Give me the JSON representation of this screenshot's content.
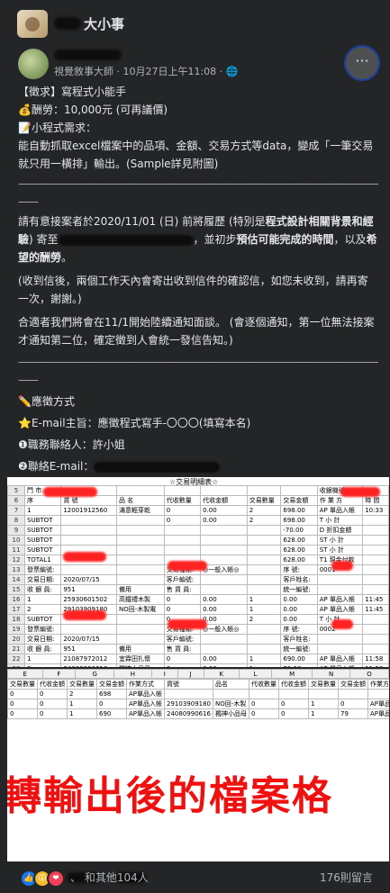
{
  "header": {
    "group_name": "大小事"
  },
  "post": {
    "meta": "視覺敘事大師 · 10月27日上午11:08 · ",
    "more_label": "···",
    "line1": "【徵求】寫程式小能手",
    "line2": "💰酬勞：10,000元 (可再議價)",
    "line3": "📝小程式需求：",
    "line4": "能自動抓取excel檔案中的品項、金額、交易方式等data，變成「一筆交易就只用一橫排」輸出。(Sample詳見附圖)",
    "separator": "———————————————————————————————————————",
    "para1_a": "請有意接案者於2020/11/01 (日) 前將履歷 (特別是",
    "para1_b": "程式設計相關背景和經驗",
    "para1_c": ") 寄至",
    "para1_d": "，並初步",
    "para1_e": "預估可能完成的時間",
    "para1_f": "，以及",
    "para1_g": "希望的酬勞",
    "para1_h": "。",
    "para2": "(收到信後，兩個工作天內會寄出收到信件的確認信，如您未收到，請再寄一次，謝謝。)",
    "para3": "合適者我們將會在11/1開始陸續通知面談。 (會逐個通知，第一位無法接案才通知第二位，確定徵到人會統一發信告知。)",
    "apply_title": "✏️應徵方式",
    "email_subject": "⭐E-mail主旨：應徵程式寫手-〇〇〇(填寫本名)",
    "contact": "❶職務聯絡人：許小姐",
    "email": "❷聯絡E-mail："
  },
  "sheet1": {
    "title": "☆交易明細表☆",
    "store_label": "門 市:",
    "receipt_label": "收銀機號:",
    "headers": [
      "序",
      "貨 號",
      "品 名",
      "代收數量",
      "代收金額",
      "交易數量",
      "交易金額",
      "作 業 方",
      "時 間"
    ],
    "rows": [
      {
        "n": "5",
        "cells": [
          "門 市:",
          "",
          "",
          "",
          "",
          "",
          "",
          "收銀機號:",
          ""
        ]
      },
      {
        "n": "6",
        "cells": [
          "序",
          "貨 號",
          "品 名",
          "代收數量",
          "代收金額",
          "交易數量",
          "交易金額",
          "作 業 方",
          "時 間"
        ]
      },
      {
        "n": "7",
        "cells": [
          "1",
          "12001912560",
          "滿意輕芽乾",
          "0",
          "0.00",
          "2",
          "698.00",
          "AP 單品入帳",
          "10:33"
        ]
      },
      {
        "n": "8",
        "cells": [
          "SUBTOT",
          "",
          "",
          "0",
          "0.00",
          "2",
          "698.00",
          "T 小 計",
          ""
        ]
      },
      {
        "n": "9",
        "cells": [
          "SUBTOT",
          "",
          "",
          "",
          "",
          "",
          "-70.00",
          "D 折扣金額",
          ""
        ]
      },
      {
        "n": "10",
        "cells": [
          "SUBTOT",
          "",
          "",
          "",
          "",
          "",
          "628.00",
          "ST 小 計",
          ""
        ]
      },
      {
        "n": "11",
        "cells": [
          "SUBTOT",
          "",
          "",
          "",
          "",
          "",
          "628.00",
          "ST 小 計",
          ""
        ]
      },
      {
        "n": "12",
        "cells": [
          "TOTAL1",
          "",
          "",
          "",
          "",
          "",
          "628.00",
          "T1 現金付款",
          ""
        ]
      },
      {
        "n": "13",
        "cells": [
          "發票編號:",
          "",
          "",
          "交易種類:",
          "◎一般入帳◎",
          "",
          "序 號:",
          "0001",
          ""
        ]
      },
      {
        "n": "14",
        "cells": [
          "交易日期:",
          "2020/07/15",
          "",
          "客戶編號:",
          "",
          "",
          "客戶姓名:",
          "",
          ""
        ]
      },
      {
        "n": "15",
        "cells": [
          "收 銀 員:",
          "951",
          "備用",
          "售 貨 員:",
          "",
          "",
          "統一編號:",
          "",
          ""
        ]
      },
      {
        "n": "16",
        "cells": [
          "1",
          "25930601502",
          "高鐵禮木製",
          "0",
          "0.00",
          "1",
          "0.00",
          "AP 單品入帳",
          "11:45"
        ]
      },
      {
        "n": "17",
        "cells": [
          "2",
          "29103909180",
          "NO回-木製電",
          "0",
          "0.00",
          "1",
          "0.00",
          "AP 單品入帳",
          "11:45"
        ]
      },
      {
        "n": "18",
        "cells": [
          "SUBTOT",
          "",
          "",
          "0",
          "0.00",
          "2",
          "0.00",
          "T 小 計",
          ""
        ]
      },
      {
        "n": "19",
        "cells": [
          "發票編號:",
          "",
          "",
          "交易種類:",
          "◎一般入帳◎",
          "",
          "序 號:",
          "0002",
          ""
        ]
      },
      {
        "n": "20",
        "cells": [
          "交易日期:",
          "2020/07/15",
          "",
          "客戶編號:",
          "",
          "",
          "客戶姓名:",
          "",
          ""
        ]
      },
      {
        "n": "21",
        "cells": [
          "收 銀 員:",
          "951",
          "備用",
          "售 貨 員:",
          "",
          "",
          "統一編號:",
          "",
          ""
        ]
      },
      {
        "n": "22",
        "cells": [
          "1",
          "21087972012",
          "宜霖田扎懷",
          "0",
          "0.00",
          "1",
          "690.00",
          "AP 單品入帳",
          "11:58"
        ]
      },
      {
        "n": "23",
        "cells": [
          "2",
          "24080990616",
          "獨神小品母",
          "0",
          "0.00",
          "1",
          "79.00",
          "AP 單品入帳",
          "11:58"
        ]
      },
      {
        "n": "24",
        "cells": [
          "SUBTOT",
          "",
          "",
          "0",
          "0.00",
          "2",
          "769.00",
          "T 小 計",
          ""
        ]
      }
    ]
  },
  "sheet2": {
    "col_letters": [
      "E",
      "F",
      "G",
      "H",
      "I",
      "J",
      "K",
      "L",
      "M",
      "N",
      "O"
    ],
    "headers": [
      "交易數量",
      "代收金額",
      "交易數量",
      "交易金額",
      "作業方式",
      "貨號",
      "品名",
      "代收數量",
      "代收金額",
      "交易數量",
      "交易金額",
      "作業方式"
    ],
    "rows": [
      [
        "0",
        "0",
        "2",
        "698",
        "AP單品入帳",
        "",
        "",
        "",
        "",
        "",
        "",
        ""
      ],
      [
        "0",
        "0",
        "1",
        "0",
        "AP單品入帳",
        "29103909180",
        "NO回-木製",
        "0",
        "0",
        "1",
        "0",
        "AP單品入帳"
      ],
      [
        "0",
        "0",
        "1",
        "690",
        "AP單品入帳",
        "24080990616",
        "獨神小品母",
        "0",
        "0",
        "1",
        "79",
        "AP單品入帳"
      ]
    ],
    "big_text": "轉輸出後的檔案格"
  },
  "footer": {
    "reactions_text": "、        和其他104人",
    "comments": "176則留言"
  },
  "colors": {
    "page_bg": "#18191a",
    "card_bg": "#242526",
    "text": "#e4e6eb",
    "muted": "#b0b3b8",
    "accent_red": "#f01010",
    "like_blue": "#1877f2"
  }
}
